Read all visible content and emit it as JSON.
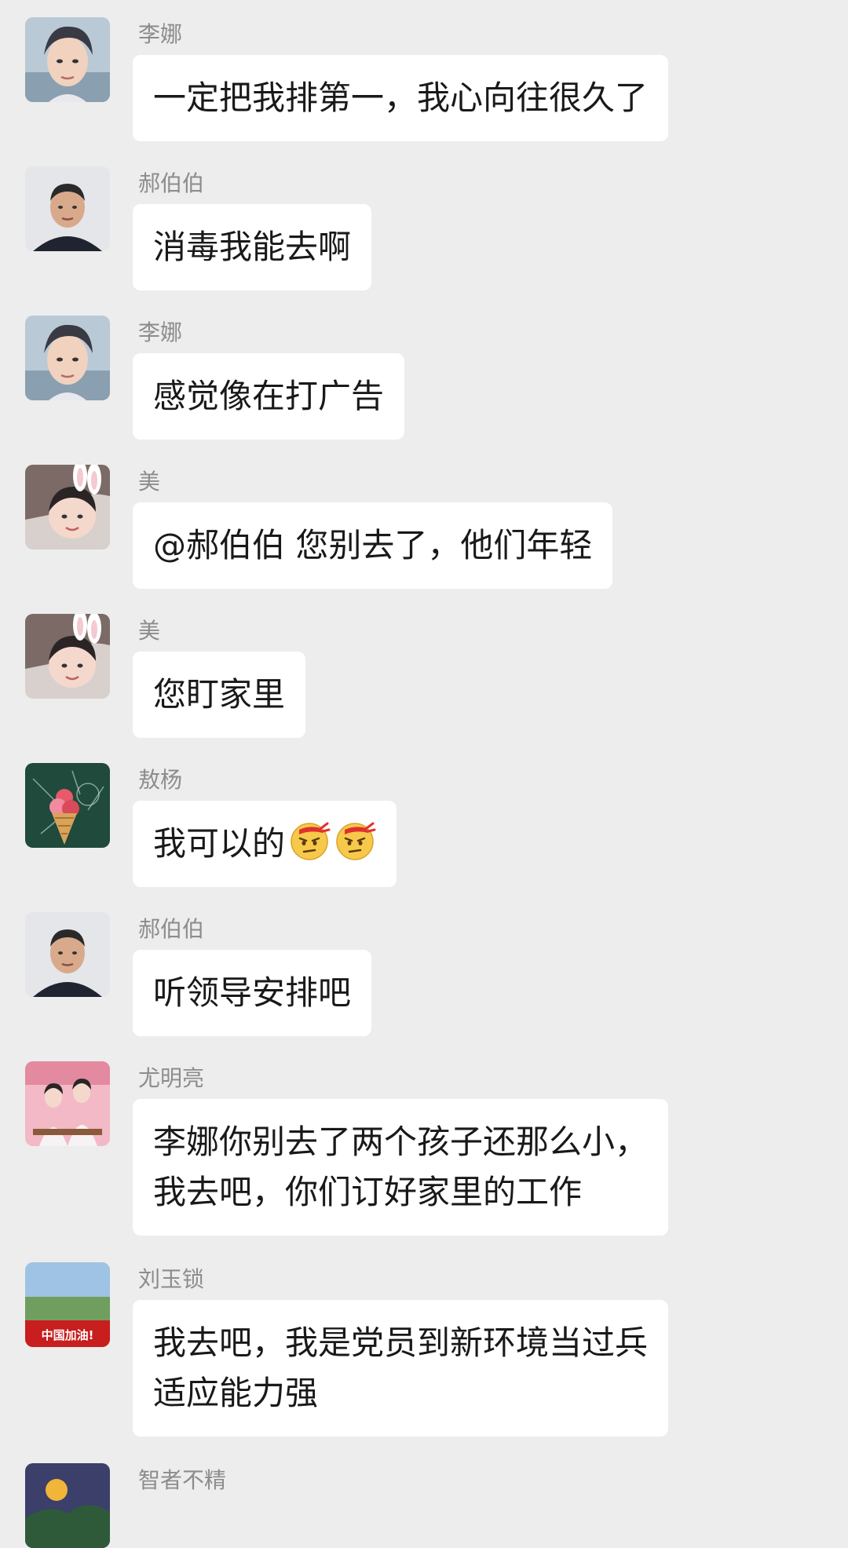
{
  "messages": [
    {
      "sender": "李娜",
      "lines": [
        "一定把我排第一，我心向往很久了"
      ],
      "avatar_icon": "woman-photo-avatar"
    },
    {
      "sender": "郝伯伯",
      "lines": [
        "消毒我能去啊"
      ],
      "avatar_icon": "older-man-photo-avatar"
    },
    {
      "sender": "李娜",
      "lines": [
        "感觉像在打广告"
      ],
      "avatar_icon": "woman-photo-avatar"
    },
    {
      "sender": "美",
      "lines": [
        "@郝伯伯  您别去了，他们年轻"
      ],
      "avatar_icon": "girl-with-bunny-ears-avatar"
    },
    {
      "sender": "美",
      "lines": [
        "您盯家里"
      ],
      "avatar_icon": "girl-with-bunny-ears-avatar"
    },
    {
      "sender": "敖杨",
      "lines": [
        "我可以的"
      ],
      "emojis": [
        "determined-face-emoji",
        "determined-face-emoji"
      ],
      "avatar_icon": "chalkboard-ice-cream-avatar"
    },
    {
      "sender": "郝伯伯",
      "lines": [
        "听领导安排吧"
      ],
      "avatar_icon": "older-man-photo-avatar"
    },
    {
      "sender": "尤明亮",
      "lines": [
        "李娜你别去了两个孩子还那么小，",
        "我去吧，你们订好家里的工作"
      ],
      "avatar_icon": "two-women-pink-avatar"
    },
    {
      "sender": "刘玉锁",
      "lines": [
        "我去吧，我是党员到新环境当过兵",
        "适应能力强"
      ],
      "avatar_icon": "china-jiayou-avatar",
      "avatar_text": "中国加油!"
    },
    {
      "sender": "智者不精",
      "lines": [],
      "avatar_icon": "landscape-avatar"
    }
  ],
  "colors": {
    "background": "#ededed",
    "bubble": "#ffffff",
    "sender_text": "#8c8c8c",
    "message_text": "#191919"
  }
}
